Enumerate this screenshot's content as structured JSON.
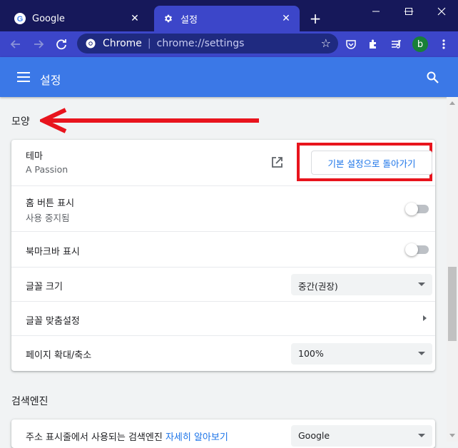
{
  "tabs": [
    {
      "title": "Google",
      "icon": "google-g-icon",
      "active": false
    },
    {
      "title": "설정",
      "icon": "gear-icon",
      "active": true
    }
  ],
  "omnibox": {
    "site": "Chrome",
    "url": "chrome://settings"
  },
  "profile": {
    "initial": "b"
  },
  "header": {
    "title": "설정"
  },
  "appearance": {
    "heading": "모양",
    "theme": {
      "label": "테마",
      "value": "A Passion",
      "reset_button": "기본 설정으로 돌아가기"
    },
    "home_button": {
      "label": "홈 버튼 표시",
      "sub": "사용 중지됨",
      "enabled": false
    },
    "bookmarks_bar": {
      "label": "북마크바 표시",
      "enabled": false
    },
    "font_size": {
      "label": "글꼴 크기",
      "value": "중간(권장)"
    },
    "customize_fonts": {
      "label": "글꼴 맞춤설정"
    },
    "page_zoom": {
      "label": "페이지 확대/축소",
      "value": "100%"
    }
  },
  "search_engine": {
    "heading": "검색엔진",
    "row_label": "주소 표시줄에서 사용되는 검색엔진",
    "learn_more": "자세히 알아보기",
    "value": "Google"
  },
  "colors": {
    "tabstrip": "#16185a",
    "toolbar": "#3c46c9",
    "appbar": "#3b78e7",
    "highlight": "#e8141d",
    "link": "#1a73e8"
  }
}
